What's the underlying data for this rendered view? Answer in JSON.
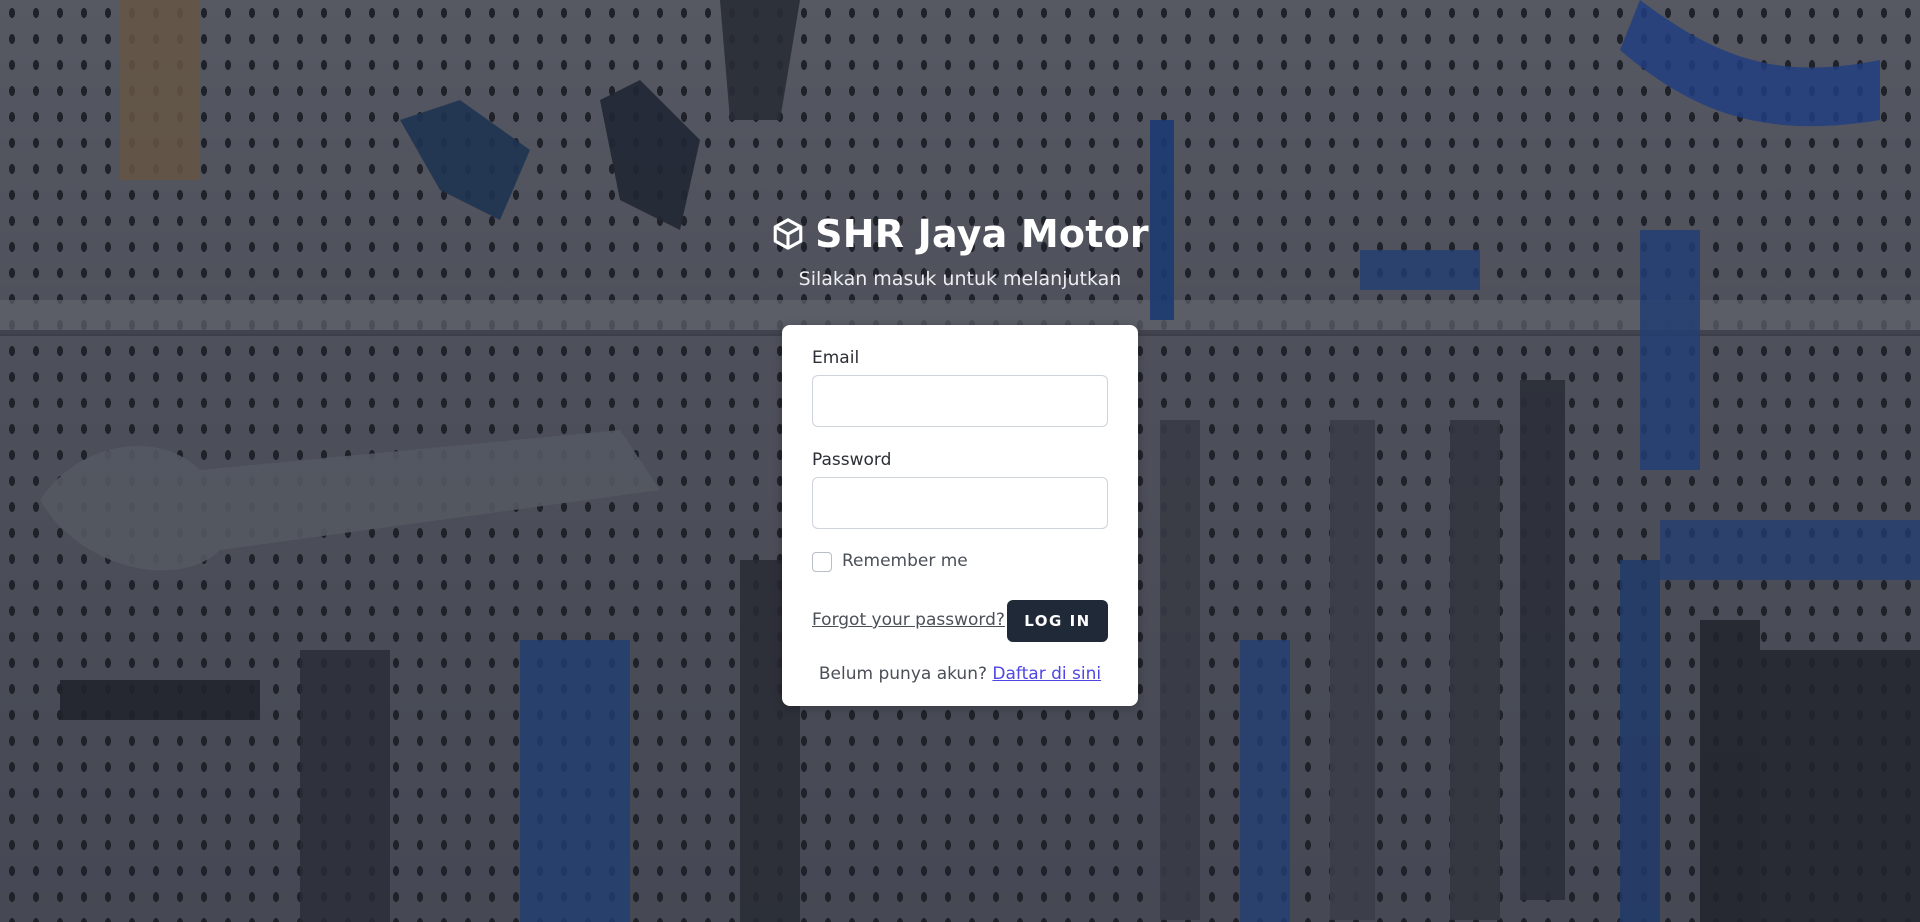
{
  "brand": {
    "title": "SHR Jaya Motor",
    "subtitle": "Silakan masuk untuk melanjutkan",
    "icon": "cube-icon"
  },
  "form": {
    "email_label": "Email",
    "email_value": "",
    "password_label": "Password",
    "password_value": "",
    "remember_label": "Remember me",
    "remember_checked": false,
    "forgot_label": "Forgot your password?",
    "login_label": "LOG IN",
    "register_prompt": "Belum punya akun?",
    "register_link": "Daftar di sini"
  },
  "colors": {
    "button_bg": "#1f2937",
    "link_accent": "#4f46e5",
    "card_bg": "#ffffff"
  }
}
